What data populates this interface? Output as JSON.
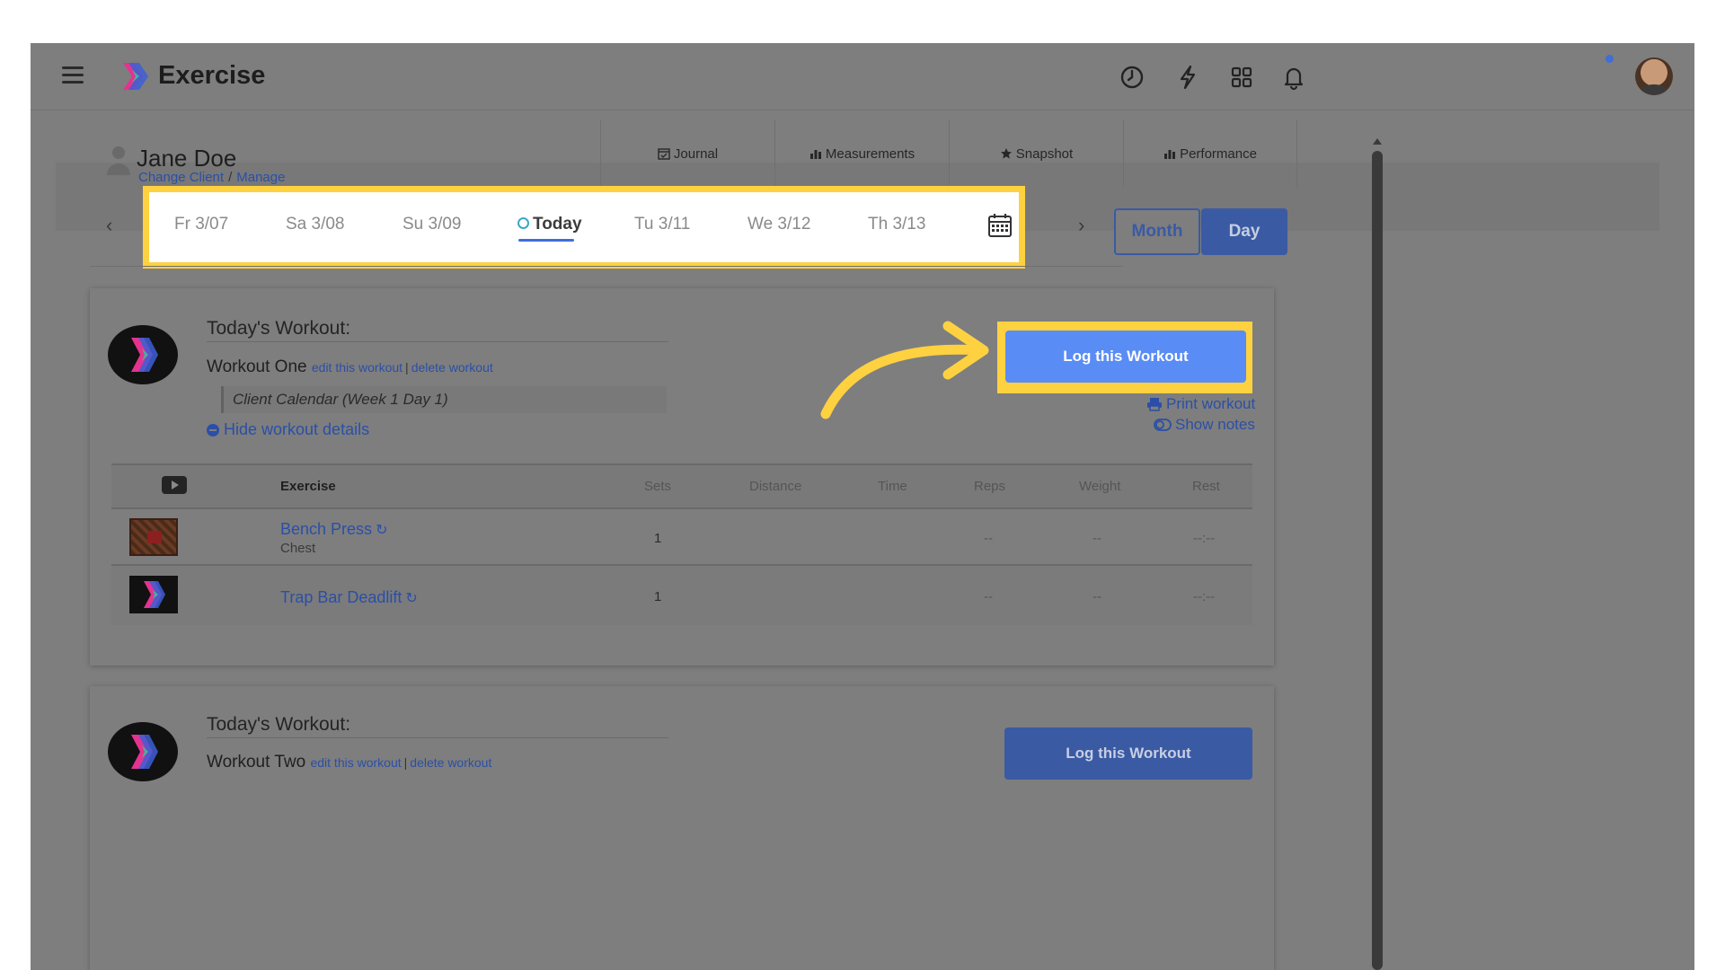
{
  "app": {
    "title": "Exercise",
    "accent": "#3f6ed8",
    "highlight": "#fed141"
  },
  "topbar": {
    "icons": [
      "menu-icon",
      "history-clock-icon",
      "lightning-icon",
      "apps-grid-icon",
      "bell-icon",
      "user-avatar"
    ]
  },
  "client": {
    "name": "Jane Doe",
    "change_client": "Change Client",
    "separator": "/",
    "manage": "Manage",
    "tabs": [
      {
        "label": "Journal",
        "icon": "calendar-check-icon"
      },
      {
        "label": "Measurements",
        "icon": "bar-chart-icon"
      },
      {
        "label": "Snapshot",
        "icon": "star-icon"
      },
      {
        "label": "Performance",
        "icon": "bar-chart-icon"
      }
    ]
  },
  "date_nav": {
    "prev": "‹",
    "next": "›",
    "days": [
      "Fr 3/07",
      "Sa 3/08",
      "Su 3/09",
      "Today",
      "Tu 3/11",
      "We 3/12",
      "Th 3/13"
    ],
    "selected": "Today",
    "view_month": "Month",
    "view_day": "Day",
    "active_view": "Day"
  },
  "workouts": [
    {
      "label": "Today's Workout:",
      "name": "Workout One",
      "edit": "edit this workout",
      "pipe": "|",
      "delete": "delete workout",
      "calendar_ref": "Client Calendar (Week 1 Day 1)",
      "hide_details": "Hide workout details",
      "log_button": "Log this Workout",
      "print": "Print workout",
      "notes": "Show notes"
    },
    {
      "label": "Today's Workout:",
      "name": "Workout Two",
      "edit": "edit this workout",
      "pipe": "|",
      "delete": "delete workout",
      "log_button": "Log this Workout"
    }
  ],
  "table": {
    "headers": [
      "Exercise",
      "Sets",
      "Distance",
      "Time",
      "Reps",
      "Weight",
      "Rest"
    ],
    "rows": [
      {
        "name": "Bench Press",
        "history_icon": "↻",
        "sub": "Chest",
        "sets": "1",
        "distance": "",
        "time": "",
        "reps": "--",
        "weight": "--",
        "rest": "--:--"
      },
      {
        "name": "Trap Bar Deadlift",
        "history_icon": "↻",
        "sub": "",
        "sets": "1",
        "distance": "",
        "time": "",
        "reps": "--",
        "weight": "--",
        "rest": "--:--"
      }
    ]
  }
}
